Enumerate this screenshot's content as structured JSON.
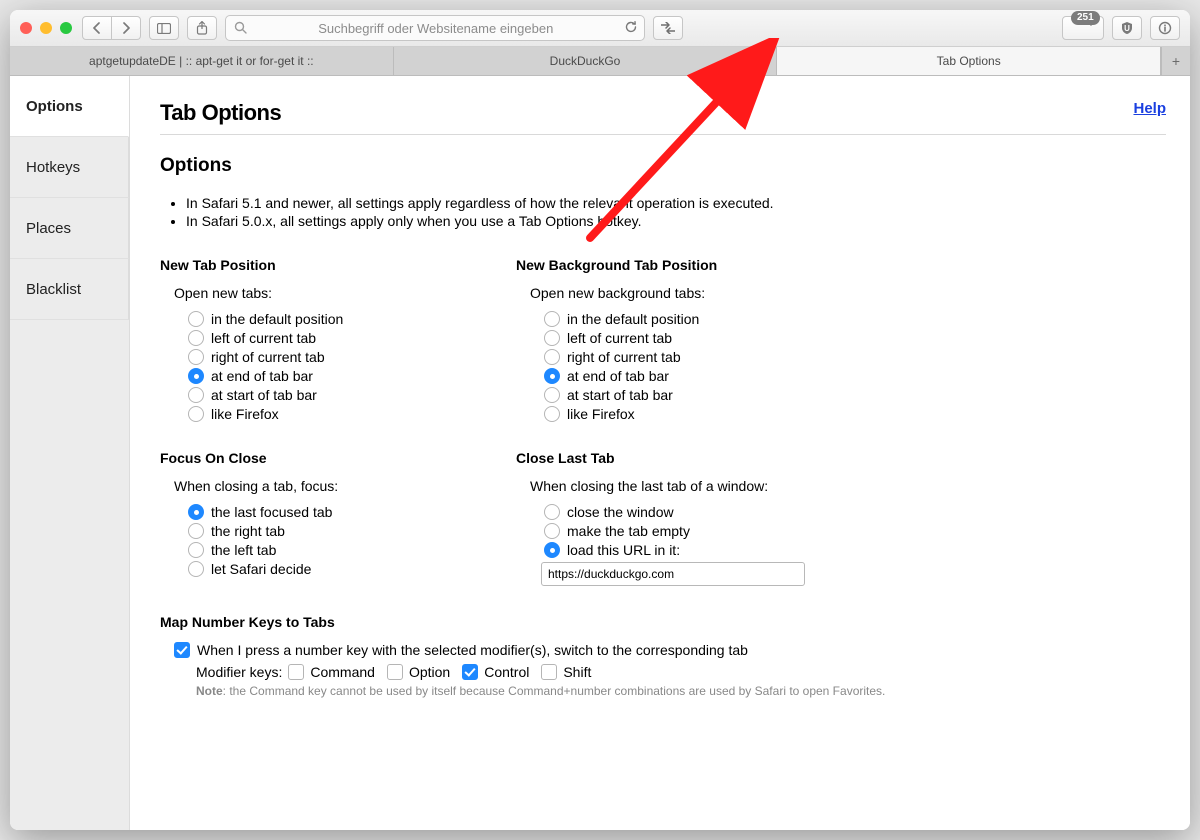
{
  "toolbar": {
    "address_placeholder": "Suchbegriff oder Websitename eingeben",
    "badge_count": "251"
  },
  "tabs": {
    "items": [
      "aptgetupdateDE | :: apt-get it or for-get it ::",
      "DuckDuckGo",
      "Tab Options"
    ]
  },
  "sidebar": {
    "items": [
      "Options",
      "Hotkeys",
      "Places",
      "Blacklist"
    ]
  },
  "header": {
    "title": "Tab Options",
    "help": "Help"
  },
  "options": {
    "title": "Options",
    "bullets": [
      "In Safari 5.1 and newer, all settings apply regardless of how the relevant operation is executed.",
      "In Safari 5.0.x, all settings apply only when you use a Tab Options hotkey."
    ],
    "new_tab": {
      "title": "New Tab Position",
      "caption": "Open new tabs:",
      "options": [
        "in the default position",
        "left of current tab",
        "right of current tab",
        "at end of tab bar",
        "at start of tab bar",
        "like Firefox"
      ],
      "selected": 3
    },
    "new_bg_tab": {
      "title": "New Background Tab Position",
      "caption": "Open new background tabs:",
      "options": [
        "in the default position",
        "left of current tab",
        "right of current tab",
        "at end of tab bar",
        "at start of tab bar",
        "like Firefox"
      ],
      "selected": 3
    },
    "focus_close": {
      "title": "Focus On Close",
      "caption": "When closing a tab, focus:",
      "options": [
        "the last focused tab",
        "the right tab",
        "the left tab",
        "let Safari decide"
      ],
      "selected": 0
    },
    "close_last": {
      "title": "Close Last Tab",
      "caption": "When closing the last tab of a window:",
      "options": [
        "close the window",
        "make the tab empty",
        "load this URL in it:"
      ],
      "selected": 2,
      "url_value": "https://duckduckgo.com"
    },
    "numkeys": {
      "title": "Map Number Keys to Tabs",
      "check_label": "When I press a number key with the selected modifier(s), switch to the corresponding tab",
      "checked": true,
      "mod_label": "Modifier keys:",
      "mods": [
        {
          "label": "Command",
          "checked": false
        },
        {
          "label": "Option",
          "checked": false
        },
        {
          "label": "Control",
          "checked": true
        },
        {
          "label": "Shift",
          "checked": false
        }
      ],
      "note_strong": "Note",
      "note_text": ": the Command key cannot be used by itself because Command+number combinations are used by Safari to open Favorites."
    }
  }
}
